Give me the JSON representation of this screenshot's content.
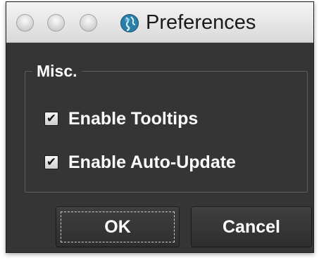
{
  "window": {
    "title": "Preferences",
    "app_icon": "globe-icon"
  },
  "misc_group": {
    "title": "Misc.",
    "options": [
      {
        "label": "Enable Tooltips",
        "checked": true
      },
      {
        "label": "Enable Auto-Update",
        "checked": true
      }
    ]
  },
  "buttons": {
    "ok_label": "OK",
    "cancel_label": "Cancel"
  },
  "colors": {
    "window_bg": "#353535",
    "titlebar": "#e6e6e6",
    "text": "#ffffff"
  }
}
